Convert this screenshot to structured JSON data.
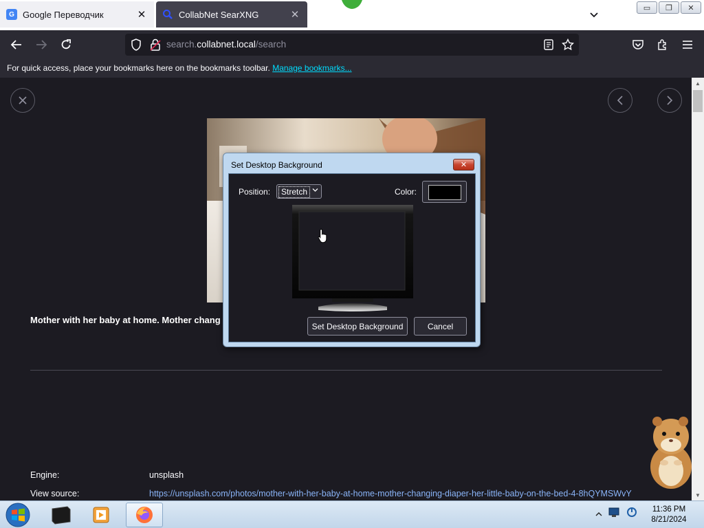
{
  "browser": {
    "tabs": [
      {
        "label": "Google Переводчик",
        "icon": "google-translate-icon",
        "active": false
      },
      {
        "label": "CollabNet SearXNG",
        "icon": "search-icon",
        "active": true
      }
    ],
    "url": {
      "prefix": "search.",
      "domain": "collabnet.local",
      "path": "/search"
    },
    "bookmarks_bar": {
      "text": "For quick access, place your bookmarks here on the bookmarks toolbar.",
      "link": "Manage bookmarks..."
    }
  },
  "page": {
    "caption": "Mother with her baby at home. Mother chang",
    "meta": {
      "engine_label": "Engine:",
      "engine_value": "unsplash",
      "source_label": "View source:",
      "source_value": "https://unsplash.com/photos/mother-with-her-baby-at-home-mother-changing-diaper-her-little-baby-on-the-bed-4-8hQYMSWvY"
    }
  },
  "dialog": {
    "title": "Set Desktop Background",
    "position_label": "Position:",
    "position_value": "Stretch",
    "color_label": "Color:",
    "color_value": "#000000",
    "set_button": "Set Desktop Background",
    "cancel_button": "Cancel"
  },
  "taskbar": {
    "time": "11:36 PM",
    "date": "8/21/2024"
  },
  "colors": {
    "page_bg": "#1c1b22",
    "toolbar_bg": "#2b2a33",
    "link": "#00ddff"
  }
}
